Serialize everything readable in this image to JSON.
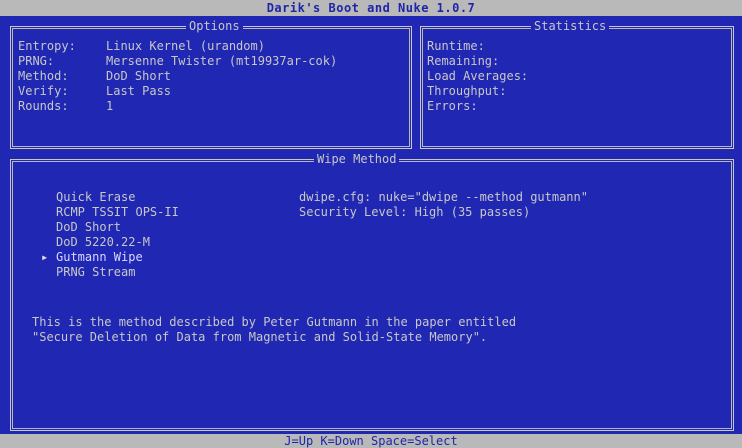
{
  "window": {
    "title": "Darik's Boot and Nuke 1.0.7"
  },
  "options": {
    "title": "Options",
    "rows": [
      {
        "label": "Entropy:",
        "value": "Linux Kernel (urandom)"
      },
      {
        "label": "PRNG:",
        "value": "Mersenne Twister (mt19937ar-cok)"
      },
      {
        "label": "Method:",
        "value": "DoD Short"
      },
      {
        "label": "Verify:",
        "value": "Last Pass"
      },
      {
        "label": "Rounds:",
        "value": "1"
      }
    ]
  },
  "statistics": {
    "title": "Statistics",
    "rows": [
      "Runtime:",
      "Remaining:",
      "Load Averages:",
      "Throughput:",
      "Errors:"
    ]
  },
  "wipe_method": {
    "title": "Wipe Method",
    "items": [
      "Quick Erase",
      "RCMP TSSIT OPS-II",
      "DoD Short",
      "DoD 5220.22-M",
      "Gutmann Wipe",
      "PRNG Stream"
    ],
    "selected_marker": "▸",
    "config_line": "dwipe.cfg: nuke=\"dwipe --method gutmann\"",
    "security_line": "Security Level: High (35 passes)",
    "description": [
      "This is the method described by Peter Gutmann in the paper entitled",
      "\"Secure Deletion of Data from Magnetic and Solid-State Memory\"."
    ]
  },
  "statusbar": {
    "text": "J=Up K=Down Space=Select"
  },
  "colors": {
    "background": "#1f27b3",
    "text": "#c8c8c8",
    "bar": "#b9b9b9",
    "bar_text": "#1f25a8"
  }
}
